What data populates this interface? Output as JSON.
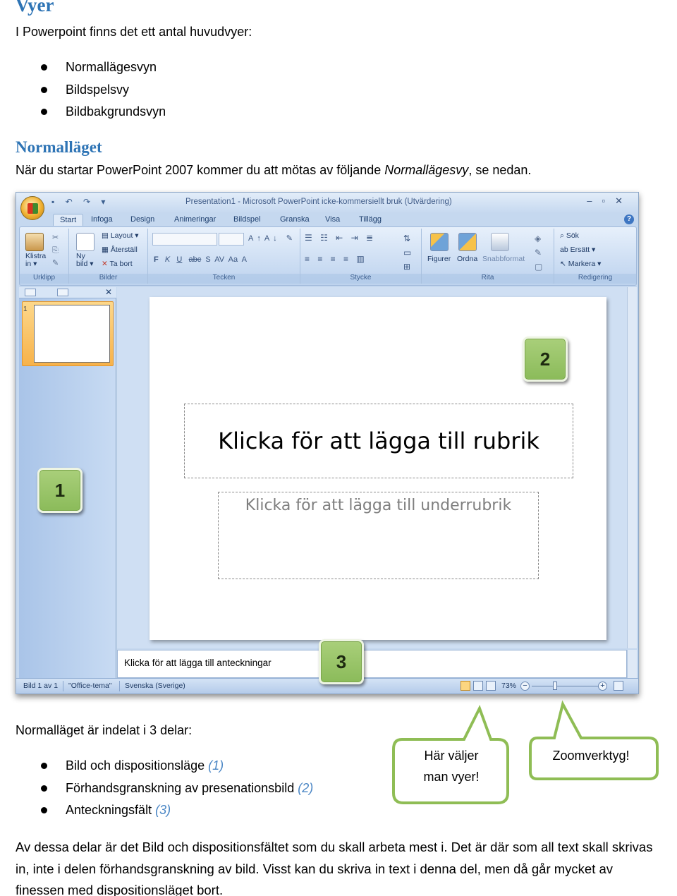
{
  "page": {
    "heading1": "Vyer",
    "intro": "I Powerpoint finns det ett antal huvudvyer:",
    "views": [
      "Normallägesvyn",
      "Bildspelsvy",
      "Bildbakgrundsvyn"
    ],
    "heading2": "Normalläget",
    "normal_intro_before": "När du startar PowerPoint 2007 kommer du att mötas av följande ",
    "normal_intro_italic": "Normallägesvy",
    "normal_intro_after": ", se nedan.",
    "parts_intro": "Normalläget är indelat i 3 delar:",
    "parts": [
      {
        "text": "Bild och dispositionsläge ",
        "ref": "(1)"
      },
      {
        "text": "Förhandsgranskning av presenationsbild ",
        "ref": "(2)"
      },
      {
        "text": "Anteckningsfält ",
        "ref": "(3)"
      }
    ],
    "body": "Av dessa delar är det Bild och dispositionsfältet som du skall arbeta mest i. Det är där som all text skall skrivas in, inte i delen förhandsgranskning av bild. Visst kan du skriva in text i denna del, men då går mycket av finessen med dispositionsläget bort."
  },
  "callouts": {
    "views_line1": "Här väljer",
    "views_line2": "man vyer!",
    "zoom": "Zoomverktyg!"
  },
  "screenshot": {
    "window_title": "Presentation1 - Microsoft PowerPoint icke-kommersiellt bruk (Utvärdering)",
    "tabs": [
      "Start",
      "Infoga",
      "Design",
      "Animeringar",
      "Bildspel",
      "Granska",
      "Visa",
      "Tillägg"
    ],
    "ribbon": {
      "urklipp": {
        "label": "Urklipp",
        "klistra_line1": "Klistra",
        "klistra_line2": "in"
      },
      "bilder": {
        "label": "Bilder",
        "ny_line1": "Ny",
        "ny_line2": "bild",
        "layout": "Layout",
        "aterstall": "Återställ",
        "ta_bort": "Ta bort"
      },
      "tecken": {
        "label": "Tecken",
        "bold": "F",
        "italic": "K",
        "underline": "U",
        "strike": "abc",
        "shadow": "S",
        "spacing": "AV",
        "case": "Aa"
      },
      "stycke": {
        "label": "Stycke"
      },
      "rita": {
        "label": "Rita",
        "figurer": "Figurer",
        "ordna": "Ordna",
        "snabbformat": "Snabbformat"
      },
      "redigering": {
        "label": "Redigering",
        "sok": "Sök",
        "ersatt": "Ersätt",
        "markera": "Markera"
      }
    },
    "slide_number": "1",
    "title_placeholder": "Klicka för att lägga till rubrik",
    "subtitle_placeholder": "Klicka för att lägga till underrubrik",
    "notes_placeholder": "Klicka för att lägga till anteckningar",
    "status": {
      "slide": "Bild 1 av 1",
      "theme": "\"Office-tema\"",
      "language": "Svenska (Sverige)",
      "zoom": "73%"
    },
    "badges": {
      "one": "1",
      "two": "2",
      "three": "3"
    }
  },
  "colors": {
    "heading": "#2e74b5",
    "ref": "#4a86c5",
    "badge": "#9bc56a",
    "callout_border": "#8fbd55"
  }
}
